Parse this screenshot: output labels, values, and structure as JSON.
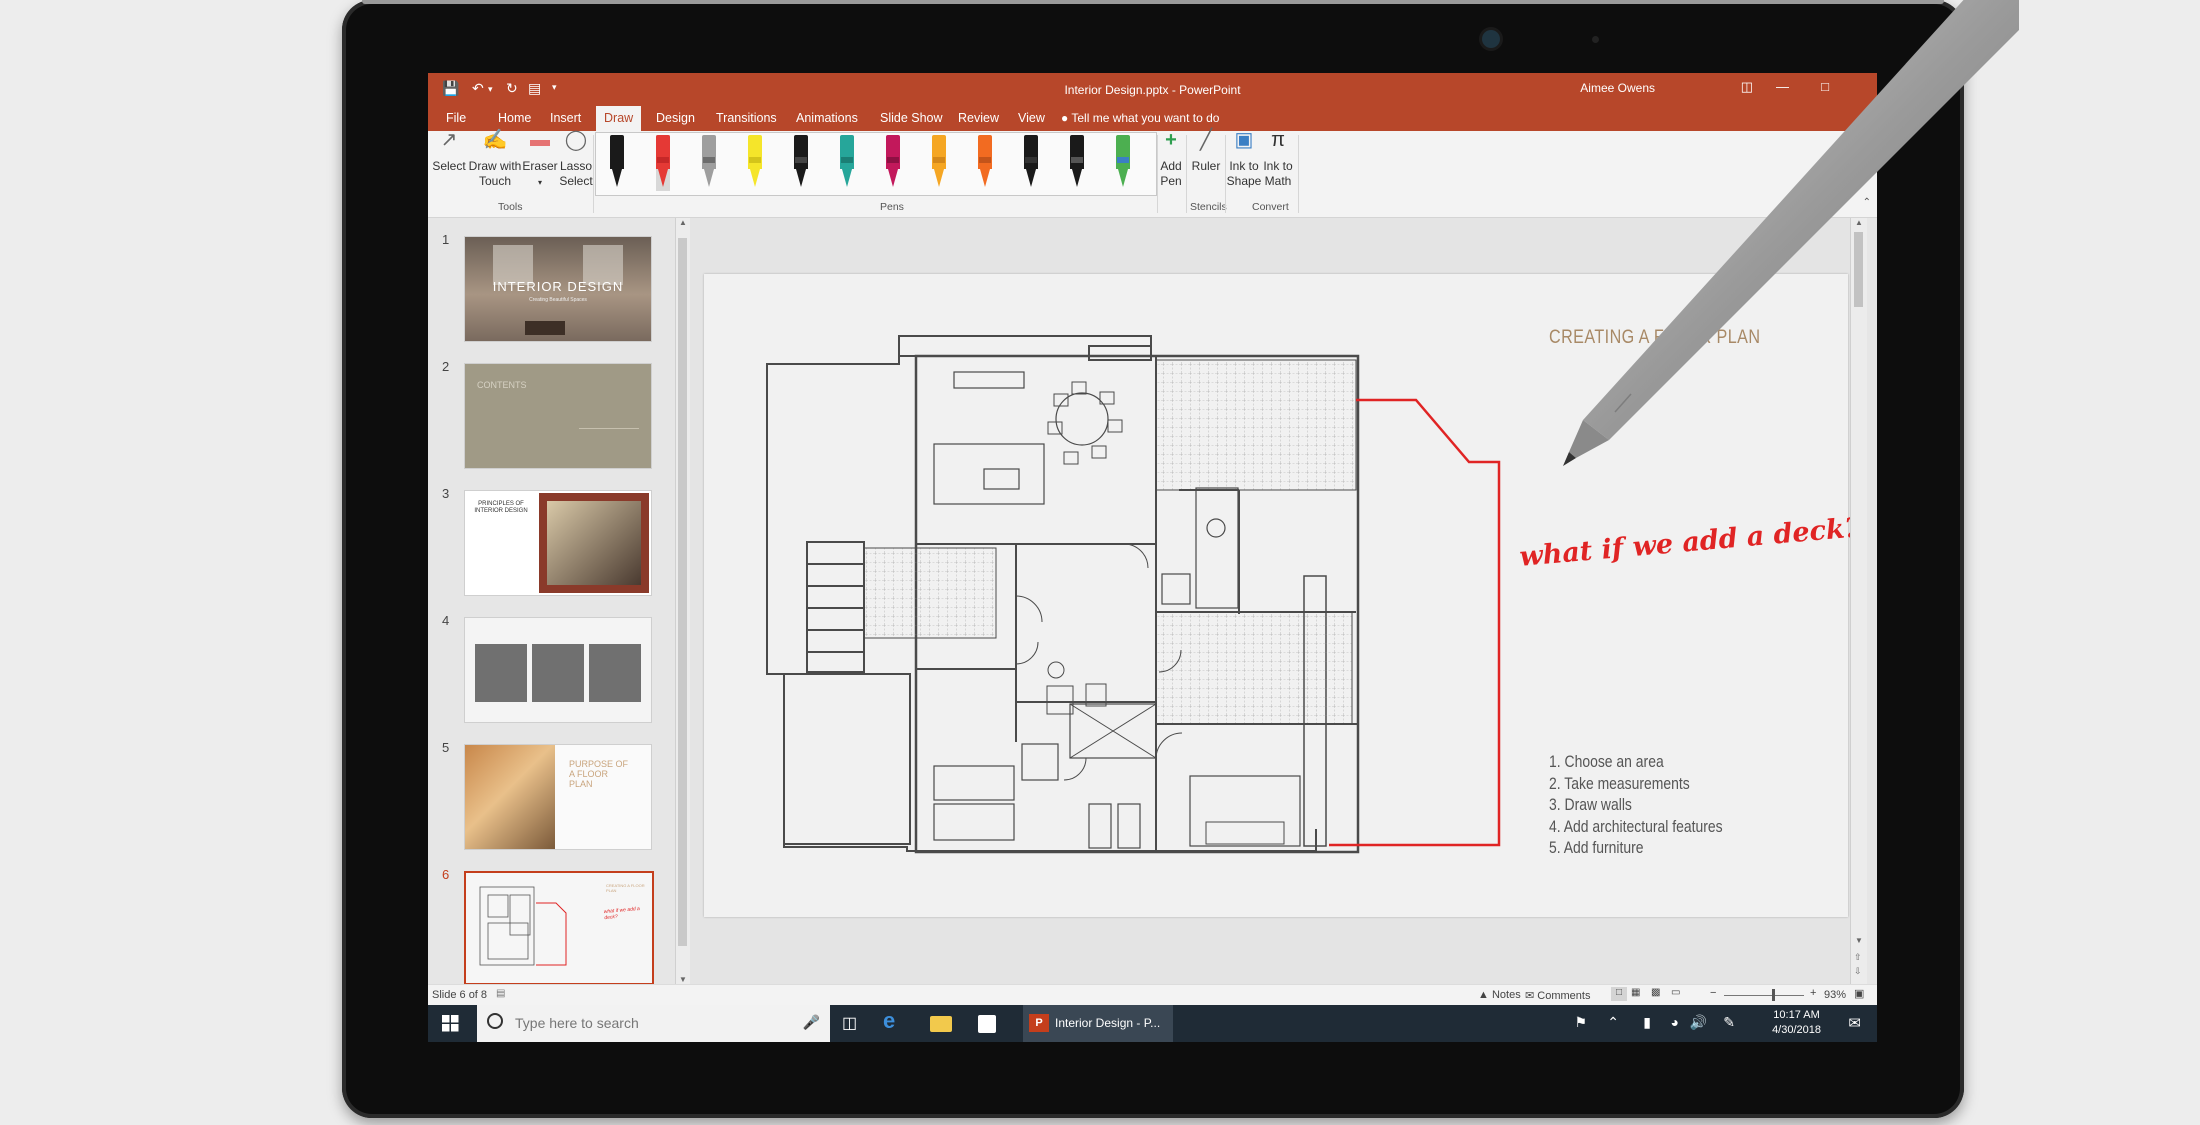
{
  "titlebar": {
    "doc_title": "Interior Design.pptx  -  PowerPoint",
    "user": "Aimee Owens"
  },
  "tabs": [
    "File",
    "Home",
    "Insert",
    "Draw",
    "Design",
    "Transitions",
    "Animations",
    "Slide Show",
    "Review",
    "View"
  ],
  "active_tab": "Draw",
  "tell_me": "Tell me what you want to do",
  "ribbon": {
    "tools": {
      "select": "Select",
      "draw_with_touch_1": "Draw with",
      "draw_with_touch_2": "Touch",
      "eraser": "Eraser",
      "lasso_1": "Lasso",
      "lasso_2": "Select",
      "group_label": "Tools"
    },
    "pens_label": "Pens",
    "pens": [
      {
        "color": "#1a1a1a",
        "band": "#1a1a1a"
      },
      {
        "color": "#e53935",
        "band": "#c62828"
      },
      {
        "color": "#9e9e9e",
        "band": "#6d6d6d"
      },
      {
        "color": "#f5e52a",
        "band": "#d4c41a"
      },
      {
        "color": "#1a1a1a",
        "band": "#444"
      },
      {
        "color": "#26a69a",
        "band": "#1b7f75"
      },
      {
        "color": "#c2185b",
        "band": "#8e1043"
      },
      {
        "color": "#f5a623",
        "band": "#d4881a"
      },
      {
        "color": "#f26b21",
        "band": "#c4541a"
      },
      {
        "color": "#1a1a1a",
        "band": "#333"
      },
      {
        "color": "#1a1a1a",
        "band": "#555"
      },
      {
        "color": "#4caf50",
        "band": "#3b7fc4"
      }
    ],
    "add_pen_1": "Add",
    "add_pen_2": "Pen",
    "ruler": "Ruler",
    "stencils_label": "Stencils",
    "ink_to_shape_1": "Ink to",
    "ink_to_shape_2": "Shape",
    "ink_to_math_1": "Ink to",
    "ink_to_math_2": "Math",
    "convert_label": "Convert"
  },
  "thumbnails": [
    {
      "num": "1",
      "title": "INTERIOR DESIGN",
      "subtitle": "Creating Beautiful Spaces"
    },
    {
      "num": "2",
      "title": "CONTENTS"
    },
    {
      "num": "3",
      "title": "PRINCIPLES OF INTERIOR DESIGN"
    },
    {
      "num": "4"
    },
    {
      "num": "5",
      "title": "PURPOSE OF A FLOOR PLAN"
    },
    {
      "num": "6",
      "title": "CREATING A FLOOR PLAN",
      "ink": "what if we add a deck?"
    }
  ],
  "slide": {
    "title": "CREATING A FLOOR PLAN",
    "ink_note": "what if we add a deck?",
    "steps": [
      "1. Choose an area",
      "2. Take measurements",
      "3. Draw walls",
      "4. Add architectural features",
      "5. Add furniture"
    ]
  },
  "status": {
    "slide_of": "Slide 6 of 8",
    "notes": "Notes",
    "comments": "Comments",
    "zoom": "93%"
  },
  "taskbar": {
    "search_placeholder": "Type here to search",
    "active_app": "Interior Design - P...",
    "time": "10:17 AM",
    "date": "4/30/2018"
  },
  "colors": {
    "accent": "#b7472a",
    "ink": "#e02424",
    "taskbar": "#1f2b36"
  }
}
